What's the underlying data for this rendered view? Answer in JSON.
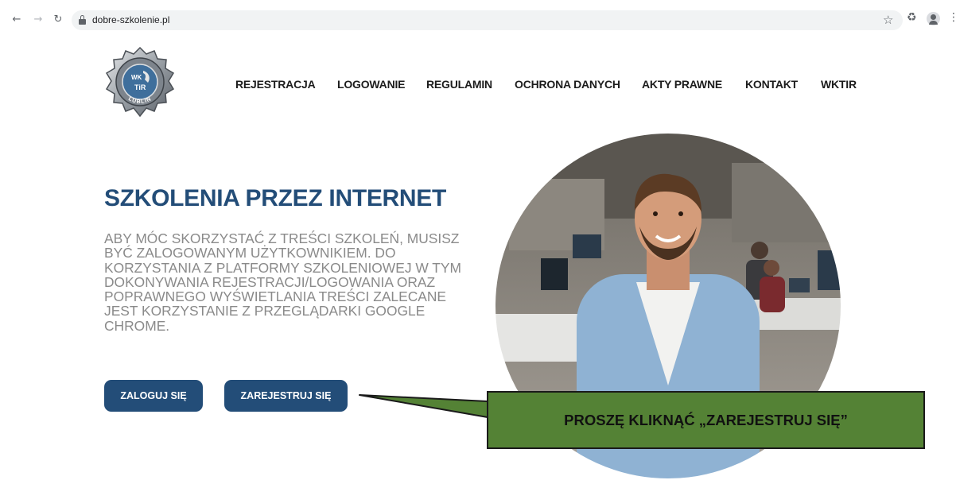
{
  "browser": {
    "url": "dobre-szkolenie.pl",
    "icons": [
      "back-icon",
      "forward-icon",
      "reload-icon",
      "lock-icon",
      "star-icon",
      "extensions-icon",
      "profile-icon",
      "menu-icon"
    ]
  },
  "logo": {
    "text_top": "WK",
    "text_mid": "TiR",
    "text_ring": "LUBLIN"
  },
  "nav": {
    "items": [
      {
        "label": "REJESTRACJA"
      },
      {
        "label": "LOGOWANIE"
      },
      {
        "label": "REGULAMIN"
      },
      {
        "label": "OCHRONA DANYCH"
      },
      {
        "label": "AKTY PRAWNE"
      },
      {
        "label": "KONTAKT"
      },
      {
        "label": "WKTIR"
      }
    ]
  },
  "hero": {
    "title": "SZKOLENIA PRZEZ INTERNET",
    "description": "Aby móc skorzystać z treści szkoleń, musisz być zalogowanym użytkownikiem. Do korzystania z platformy szkoleniowej w tym dokonywania rejestracji/logowania oraz poprawnego wyświetlania treści zalecane jest korzystanie z przeglądarki Google Chrome.",
    "login_label": "ZALOGUJ SIĘ",
    "register_label": "ZAREJESTRUJ SIĘ"
  },
  "callout": {
    "text": "PROSZĘ KLIKNĄĆ „ZAREJESTRUJ SIĘ”"
  },
  "colors": {
    "accent": "#234d78",
    "callout_fill": "#548235",
    "body_text": "#8a8a8a"
  }
}
